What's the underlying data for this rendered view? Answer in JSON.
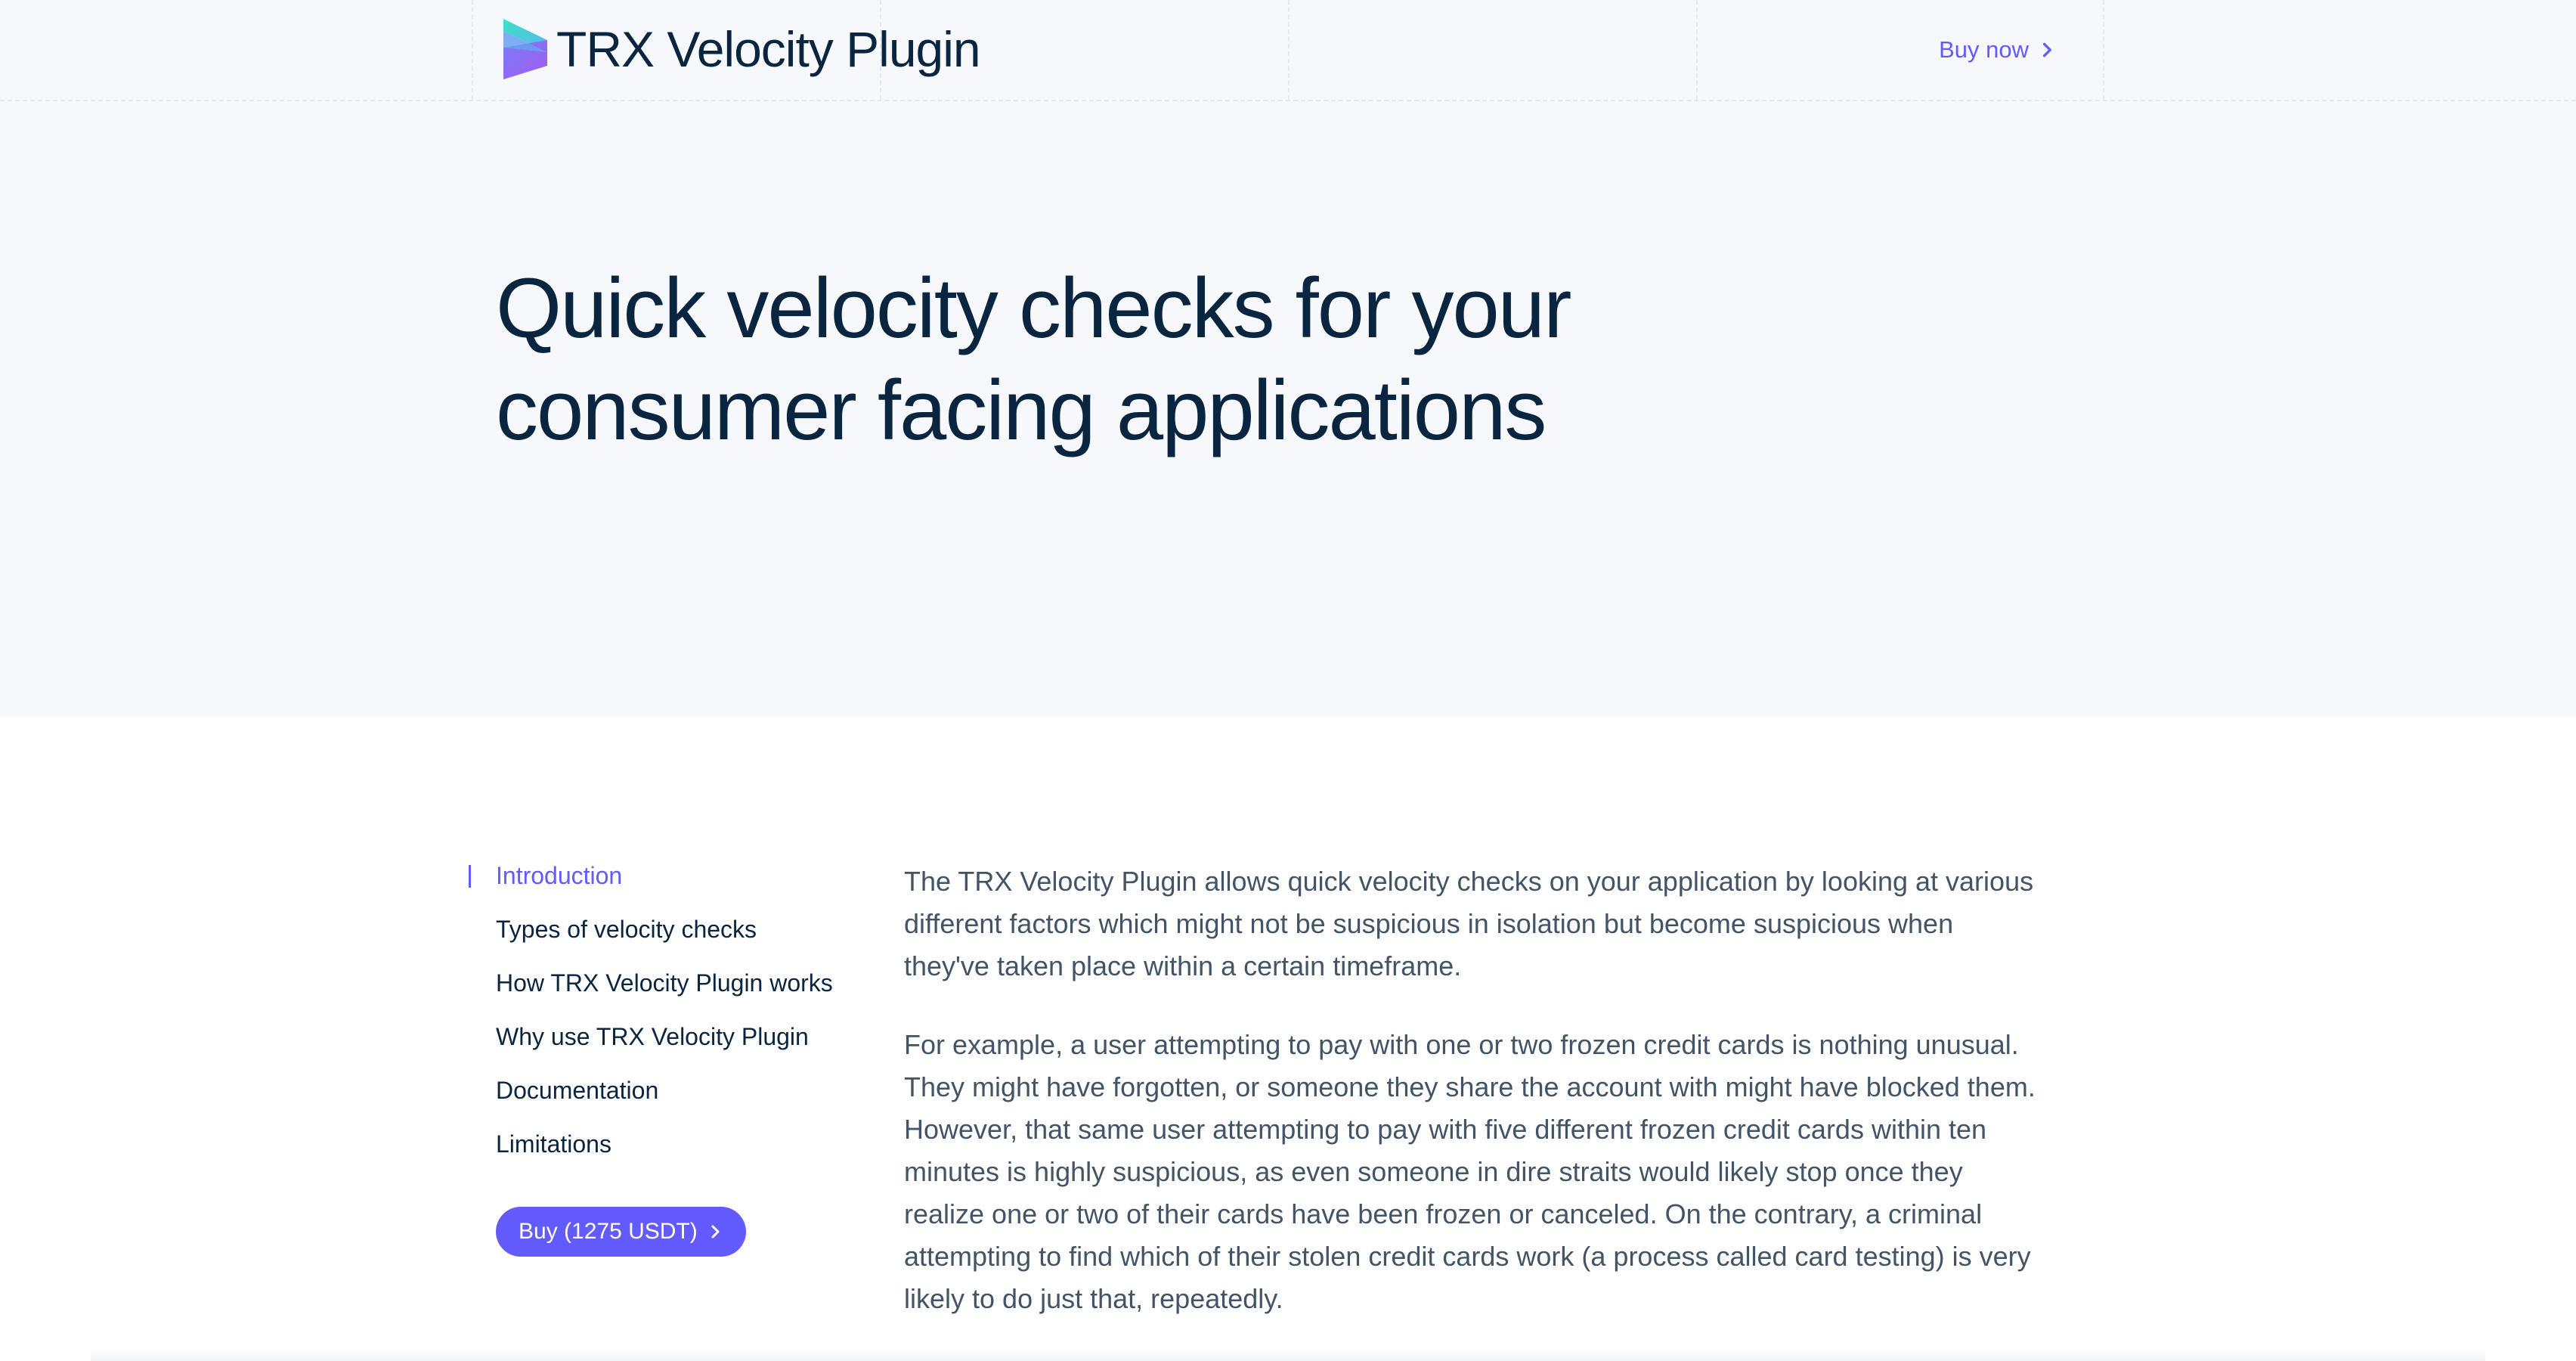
{
  "header": {
    "brand_name": "TRX Velocity Plugin",
    "buy_now_label": "Buy now"
  },
  "hero": {
    "title": "Quick velocity checks for your consumer facing applications"
  },
  "sidebar": {
    "items": [
      {
        "label": "Introduction",
        "active": true
      },
      {
        "label": "Types of velocity checks",
        "active": false
      },
      {
        "label": "How TRX Velocity Plugin works",
        "active": false
      },
      {
        "label": "Why use TRX Velocity Plugin",
        "active": false
      },
      {
        "label": "Documentation",
        "active": false
      },
      {
        "label": "Limitations",
        "active": false
      }
    ],
    "buy_button_label": "Buy (1275 USDT)"
  },
  "content": {
    "paragraphs": [
      "The TRX Velocity Plugin allows quick velocity checks on your application by looking at various different factors which might not be suspicious in isolation but become suspicious when they've taken place within a certain timeframe.",
      "For example, a user attempting to pay with one or two frozen credit cards is nothing unusual. They might have forgotten, or someone they share the account with might have blocked them. However, that same user attempting to pay with five different frozen credit cards within ten minutes is highly suspicious, as even someone in dire straits would likely stop once they realize one or two of their cards have been frozen or canceled. On the contrary, a criminal attempting to find which of their stolen credit cards work (a process called card testing) is very likely to do just that, repeatedly."
    ]
  },
  "icons": {
    "logo": "velocity-logo-icon",
    "chevron": "chevron-right-icon"
  },
  "colors": {
    "accent": "#635bff",
    "heading": "#0a2540",
    "body_text": "#425466",
    "hero_background": "#f6f8fc",
    "logo_gradient_top": "#3ee0c8",
    "logo_gradient_bottom": "#8a5cf6"
  }
}
